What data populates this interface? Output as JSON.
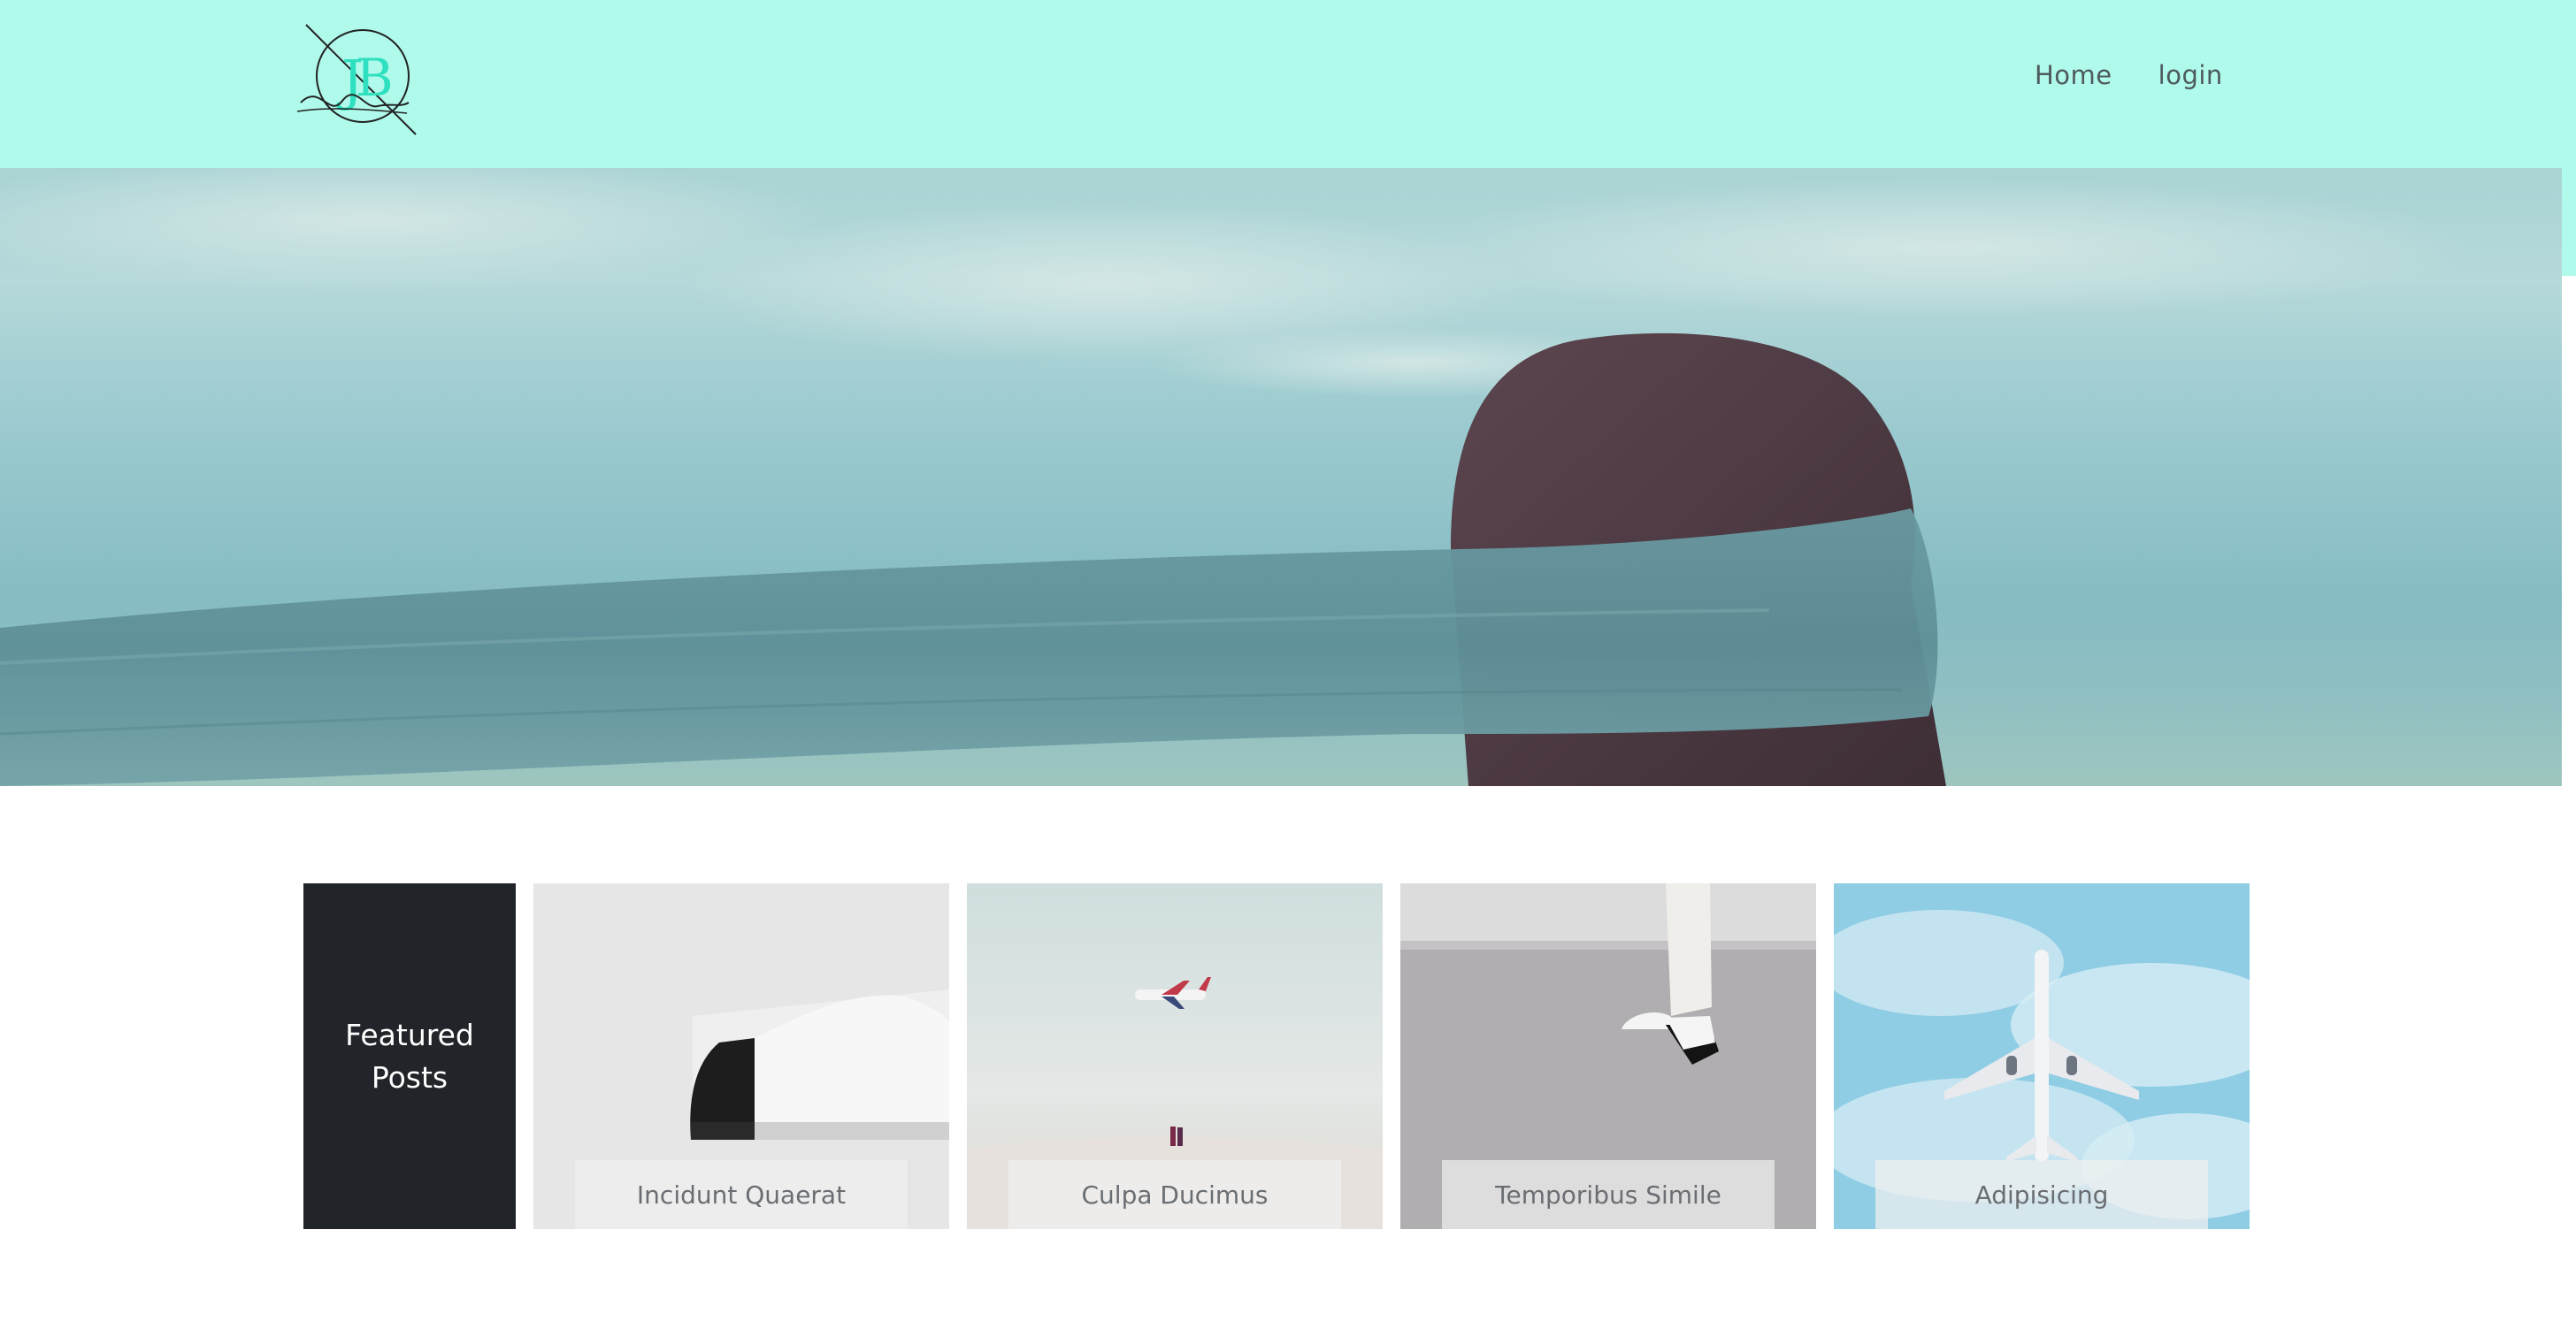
{
  "header": {
    "logo_alt": "JB Studio",
    "nav": [
      {
        "label": "Home"
      },
      {
        "label": "login"
      }
    ]
  },
  "featured": {
    "title": "Featured Posts",
    "cards": [
      {
        "title": "Incidunt Quaerat",
        "image": "sneaker-photo"
      },
      {
        "title": "Culpa Ducimus",
        "image": "airplane-over-sand-photo"
      },
      {
        "title": "Temporibus Simile",
        "image": "legs-sneakers-photo"
      },
      {
        "title": "Adipisicing",
        "image": "airplane-sky-photo"
      }
    ]
  },
  "colors": {
    "header_bg": "#affaea",
    "nav_text": "#4e5a5e",
    "featured_box_bg": "#212429",
    "logo_accent": "#2fe0c0"
  }
}
